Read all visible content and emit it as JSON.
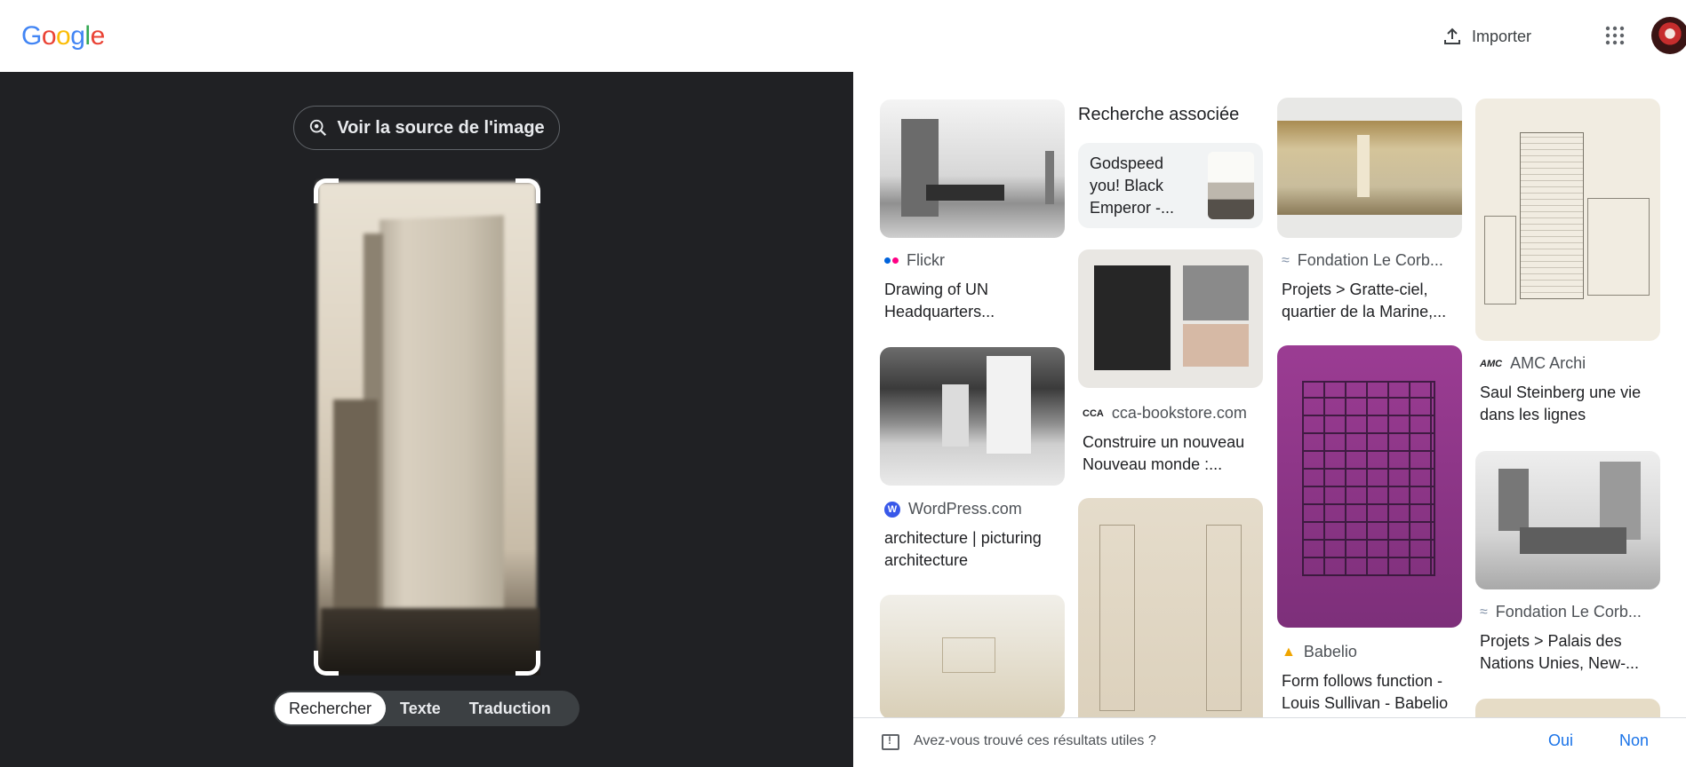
{
  "header": {
    "logo_letters": [
      "G",
      "o",
      "o",
      "g",
      "l",
      "e"
    ],
    "import_label": "Importer",
    "apps_icon": "apps-grid-icon",
    "avatar_icon": "user-avatar"
  },
  "viewer": {
    "source_button": "Voir la source de l'image",
    "tabs": [
      {
        "label": "Rechercher",
        "active": true
      },
      {
        "label": "Texte",
        "active": false
      },
      {
        "label": "Traduction",
        "active": false
      }
    ]
  },
  "related": {
    "heading": "Recherche associée",
    "query": "Godspeed you! Black Emperor -..."
  },
  "results": [
    {
      "source": "Flickr",
      "title": "Drawing of UN Headquarters...",
      "source_icon_color": "#ff0084"
    },
    {
      "source": "WordPress.com",
      "title": "architecture | picturing architecture",
      "source_icon_color": "#3858e9"
    },
    {
      "source": "cca-bookstore.com",
      "title": "Construire un nouveau Nouveau monde :...",
      "source_icon_color": "#202124"
    },
    {
      "source": "Fondation Le Corb...",
      "title": "Projets > Gratte-ciel, quartier de la Marine,...",
      "source_icon_color": "#7f8fa6"
    },
    {
      "source": "Babelio",
      "title": "Form follows function - Louis Sullivan - Babelio",
      "source_icon_color": "#f0a500"
    },
    {
      "source": "AMC Archi",
      "title": "Saul Steinberg une vie dans les lignes",
      "source_icon_color": "#202124"
    },
    {
      "source": "Fondation Le Corb...",
      "title": "Projets > Palais des Nations Unies, New-...",
      "source_icon_color": "#7f8fa6"
    }
  ],
  "feedback": {
    "question": "Avez-vous trouvé ces résultats utiles ?",
    "yes": "Oui",
    "no": "Non"
  }
}
